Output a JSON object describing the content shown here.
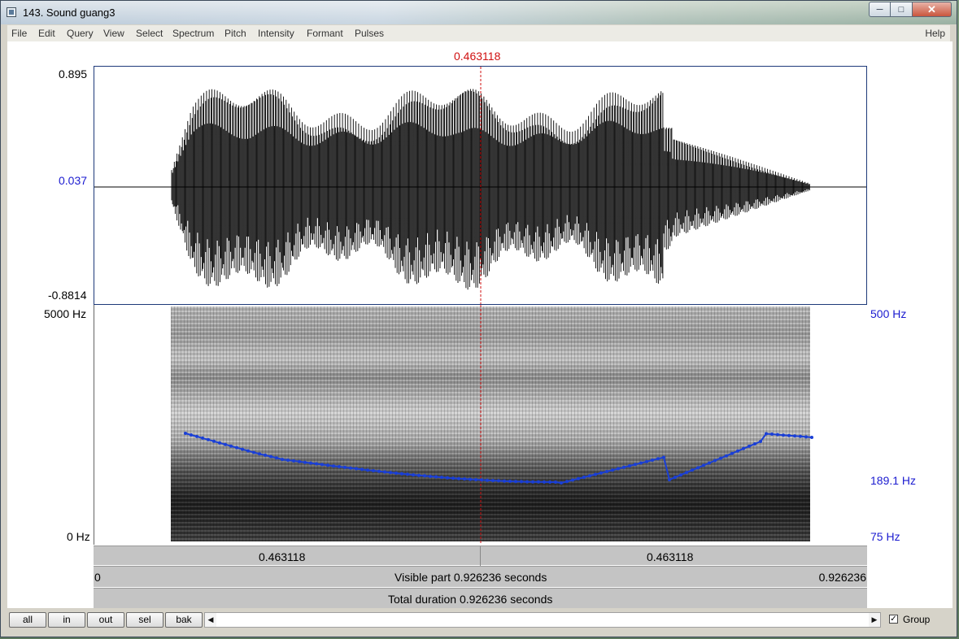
{
  "window": {
    "title": "143. Sound guang3",
    "minimize": "─",
    "maximize": "□",
    "close": "✕"
  },
  "menu": [
    "File",
    "Edit",
    "Query",
    "View",
    "Select",
    "Spectrum",
    "Pitch",
    "Intensity",
    "Formant",
    "Pulses"
  ],
  "menu_help": "Help",
  "cursor_time": "0.463118",
  "waveform": {
    "max": "0.895",
    "cursor_value": "0.037",
    "min": "-0.8814"
  },
  "spectrogram": {
    "top_freq": "5000 Hz",
    "bottom_freq": "0 Hz"
  },
  "pitch": {
    "top": "500 Hz",
    "current": "189.1 Hz",
    "bottom": "75 Hz",
    "color": "#1a3fd6"
  },
  "time_bar": {
    "left": "0.463118",
    "right": "0.463118"
  },
  "visible_bar": {
    "start": "0",
    "label": "Visible part 0.926236 seconds",
    "end": "0.926236"
  },
  "total_bar": {
    "label": "Total duration 0.926236 seconds"
  },
  "buttons": {
    "all": "all",
    "in": "in",
    "out": "out",
    "sel": "sel",
    "bak": "bak"
  },
  "scroll": {
    "left_arrow": "◀",
    "right_arrow": "▶"
  },
  "group": {
    "label": "Group",
    "checked": true,
    "mark": "✓"
  }
}
